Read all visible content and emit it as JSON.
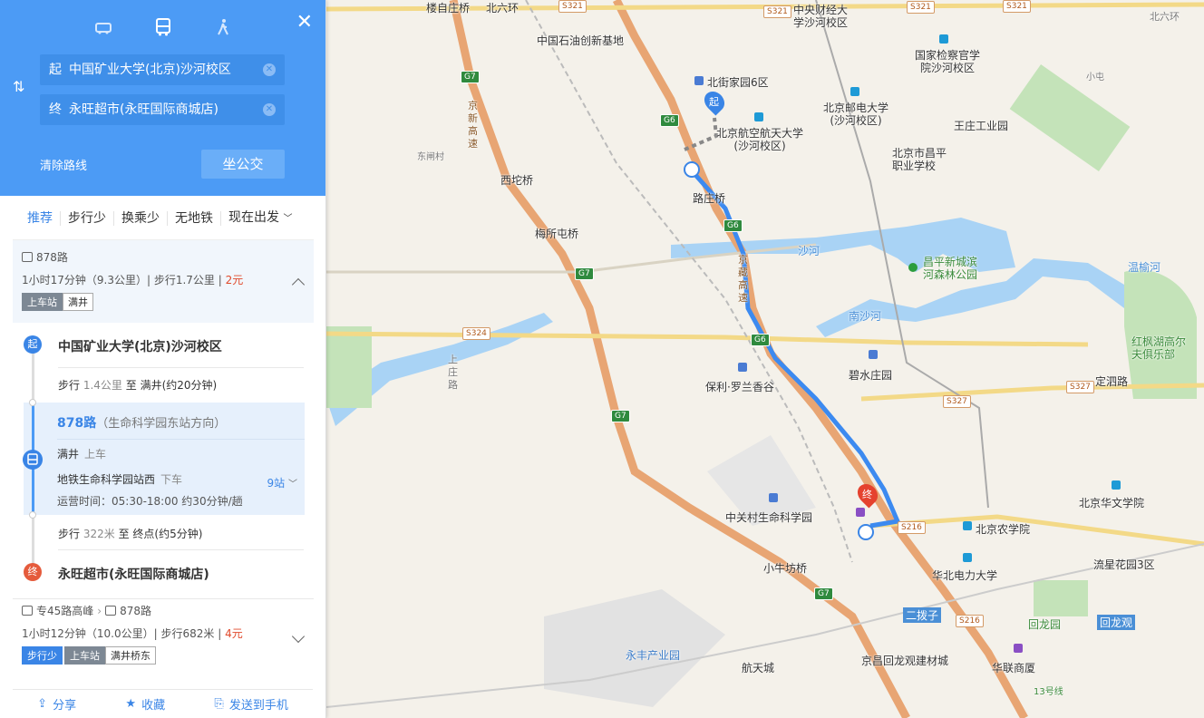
{
  "search": {
    "modes": [
      "drive-icon",
      "bus-icon",
      "walk-icon"
    ],
    "start_tag": "起",
    "start": "中国矿业大学(北京)沙河校区",
    "end_tag": "终",
    "end": "永旺超市(永旺国际商城店)",
    "clear_route": "清除路线",
    "submit": "坐公交"
  },
  "tabs": [
    "推荐",
    "步行少",
    "换乘少",
    "无地铁",
    "现在出发"
  ],
  "plan1": {
    "line": "878路",
    "info_prefix": "1小时17分钟（9.3公里）| 步行1.7公里 | ",
    "price": "2元",
    "tag_label": "上车站",
    "tag_value": "满井"
  },
  "detail": {
    "start_dot": "起",
    "start_name": "中国矿业大学(北京)沙河校区",
    "walk1_a": "步行",
    "walk1_dist": "1.4公里",
    "walk1_b": "至 满井(约20分钟)",
    "bus_line": "878路",
    "bus_dir": "（生命科学园东站方向）",
    "board_stop": "满井",
    "board_label": "上车",
    "alight_stop": "地铁生命科学园站西",
    "alight_label": "下车",
    "hours": "运营时间：05:30-18:00 约30分钟/趟",
    "stops": "9站",
    "walk2_a": "步行",
    "walk2_dist": "322米",
    "walk2_b": "至 终点(约5分钟)",
    "end_dot": "终",
    "end_name": "永旺超市(永旺国际商城店)"
  },
  "plan2": {
    "line_a": "专45路高峰",
    "line_b": "878路",
    "info_prefix": "1小时12分钟（10.0公里）| 步行682米 | ",
    "price": "4元",
    "tag1": "步行少",
    "tag_label": "上车站",
    "tag_value": "满井桥东"
  },
  "actions": [
    "分享",
    "收藏",
    "发送到手机"
  ],
  "map": {
    "labels": [
      {
        "t": "楼自庄桥"
      },
      {
        "t": "北六环"
      },
      {
        "t": "中国石油创新基地"
      },
      {
        "t": "北街家园6区"
      },
      {
        "t": "中央财经大学沙河校区"
      },
      {
        "t": "国家检察官学院沙河校区"
      },
      {
        "t": "北京邮电大学(沙河校区)"
      },
      {
        "t": "北京航空航天大学(沙河校区)"
      },
      {
        "t": "王庄工业园"
      },
      {
        "t": "北京市昌平职业学校"
      },
      {
        "t": "西坨桥"
      },
      {
        "t": "路庄桥"
      },
      {
        "t": "梅所屯桥"
      },
      {
        "t": "沙河"
      },
      {
        "t": "昌平新城滨河森林公园"
      },
      {
        "t": "温榆河"
      },
      {
        "t": "南沙河"
      },
      {
        "t": "碧水庄园"
      },
      {
        "t": "保利·罗兰香谷"
      },
      {
        "t": "红枫湖高尔夫俱乐部"
      },
      {
        "t": "定泗路"
      },
      {
        "t": "中关村生命科学园"
      },
      {
        "t": "北京华文学院"
      },
      {
        "t": "北京农学院"
      },
      {
        "t": "华北电力大学"
      },
      {
        "t": "流星花园3区"
      },
      {
        "t": "小牛坊桥"
      },
      {
        "t": "二拨子"
      },
      {
        "t": "回龙园"
      },
      {
        "t": "回龙观"
      },
      {
        "t": "永丰产业园"
      },
      {
        "t": "航天城"
      },
      {
        "t": "京昌回龙观建材城"
      },
      {
        "t": "华联商厦"
      },
      {
        "t": "东闸村"
      },
      {
        "t": "上庄路"
      },
      {
        "t": "13号线"
      },
      {
        "t": "小屯"
      },
      {
        "t": "北六环"
      },
      {
        "t": "京藏高速"
      },
      {
        "t": "京新高速"
      }
    ],
    "start_marker": "起",
    "end_marker": "终"
  }
}
